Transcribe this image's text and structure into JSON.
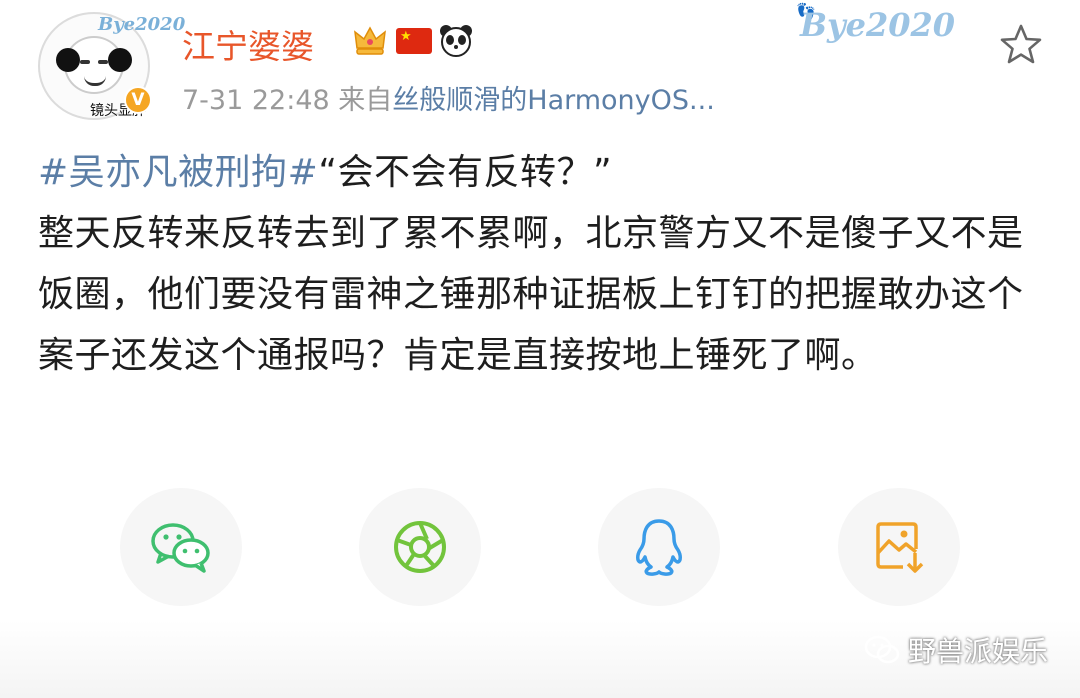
{
  "user": {
    "name": "江宁婆婆",
    "avatar_caption": "镜头显胖",
    "avatar_decoration": "Bye2020",
    "verified_mark": "V",
    "badges": [
      "crown-icon",
      "china-flag-icon",
      "panda-icon"
    ]
  },
  "post": {
    "time": "7-31 22:48",
    "source_prefix": "来自",
    "source_link": "丝般顺滑的HarmonyOS...",
    "hashtag": "#吴亦凡被刑拘#",
    "body_first": "“会不会有反转？”",
    "body_rest": "整天反转来反转去到了累不累啊，北京警方又不是傻子又不是饭圈，他们要没有雷神之锤那种证据板上钉钉的把握敢办这个案子还发这个通报吗？肯定是直接按地上锤死了啊。"
  },
  "decor": {
    "header_sticker": "Bye2020"
  },
  "share": {
    "buttons": [
      {
        "icon": "wechat-icon",
        "color": "#3fbf6f"
      },
      {
        "icon": "moments-icon",
        "color": "#72c43c"
      },
      {
        "icon": "qq-icon",
        "color": "#3a9be8"
      },
      {
        "icon": "save-image-icon",
        "color": "#f0a32a"
      }
    ]
  },
  "watermark": {
    "text": "野兽派娱乐"
  },
  "colors": {
    "username": "#e8562a",
    "link": "#5b7ea6",
    "meta": "#9a9a9a"
  }
}
